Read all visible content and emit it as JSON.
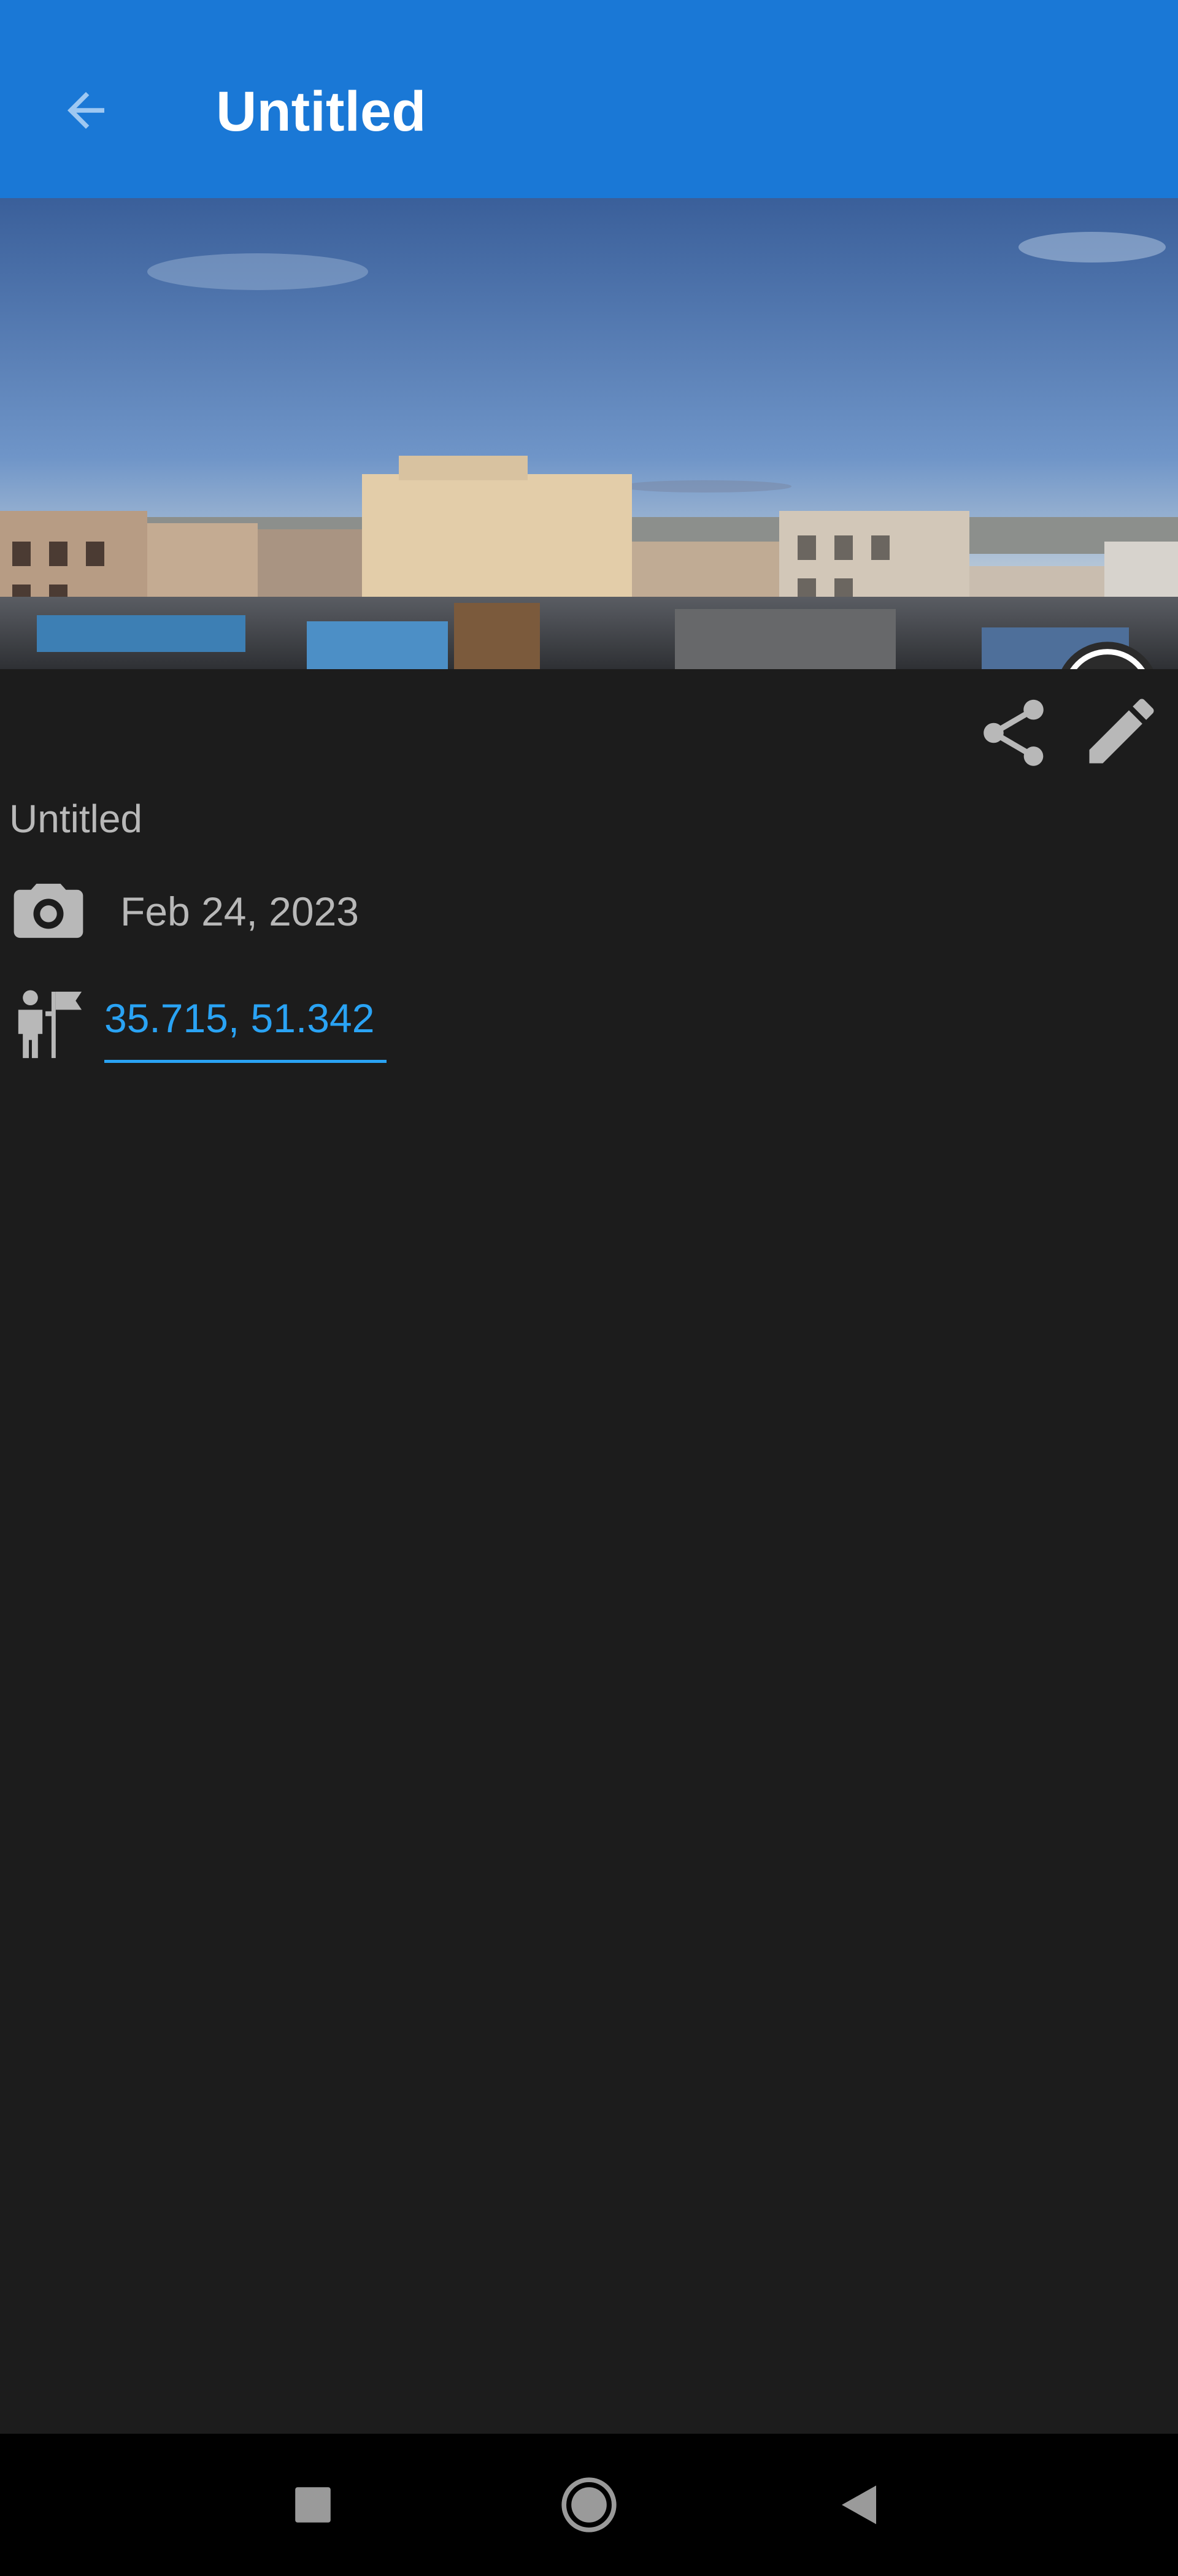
{
  "appbar": {
    "title": "Untitled",
    "back_icon": "arrow-left-icon",
    "color": "#1a78d6"
  },
  "panorama": {
    "compass_icon": "compass-icon"
  },
  "actions": {
    "share_icon": "share-icon",
    "edit_icon": "pencil-icon"
  },
  "details": {
    "name": "Untitled",
    "date_icon": "camera-icon",
    "date": "Feb 24, 2023",
    "location_icon": "person-flag-icon",
    "coordinates": "35.715, 51.342",
    "link_color": "#2aa3f4"
  },
  "navbar": {
    "recents_icon": "square-icon",
    "home_icon": "circle-icon",
    "back_icon": "triangle-back-icon"
  }
}
